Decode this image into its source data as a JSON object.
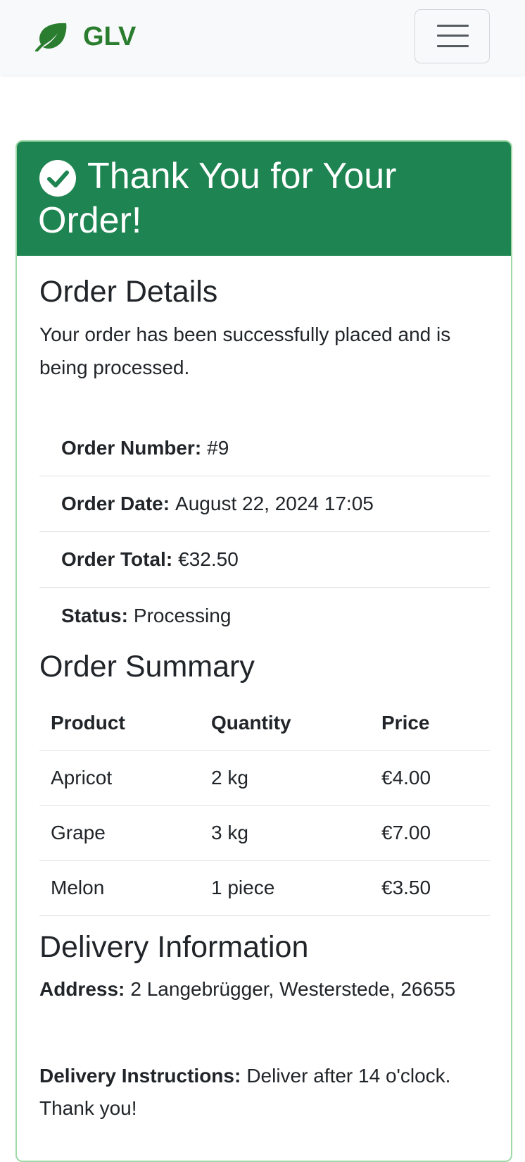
{
  "navbar": {
    "brand": "GLV",
    "brand_icon": "leaf-icon",
    "brand_color": "#2a7d2e",
    "menu_icon": "hamburger-menu-icon"
  },
  "confirmation": {
    "title": "Thank You for Your Order!",
    "header_color": "#1e8552",
    "icon": "check-circle-icon"
  },
  "order_details": {
    "heading": "Order Details",
    "message": "Your order has been successfully placed and is being processed.",
    "items": [
      {
        "label": "Order Number:",
        "value": "#9"
      },
      {
        "label": "Order Date:",
        "value": "August 22, 2024 17:05"
      },
      {
        "label": "Order Total:",
        "value": "€32.50"
      },
      {
        "label": "Status:",
        "value": "Processing"
      }
    ]
  },
  "order_summary": {
    "heading": "Order Summary",
    "columns": [
      "Product",
      "Quantity",
      "Price"
    ],
    "rows": [
      {
        "product": "Apricot",
        "quantity": "2 kg",
        "price": "€4.00"
      },
      {
        "product": "Grape",
        "quantity": "3 kg",
        "price": "€7.00"
      },
      {
        "product": "Melon",
        "quantity": "1 piece",
        "price": "€3.50"
      }
    ]
  },
  "delivery": {
    "heading": "Delivery Information",
    "address_label": "Address:",
    "address": "2 Langebrügger, Westerstede, 26655",
    "instructions_label": "Delivery Instructions:",
    "instructions": "Deliver after 14 o'clock. Thank you!"
  }
}
